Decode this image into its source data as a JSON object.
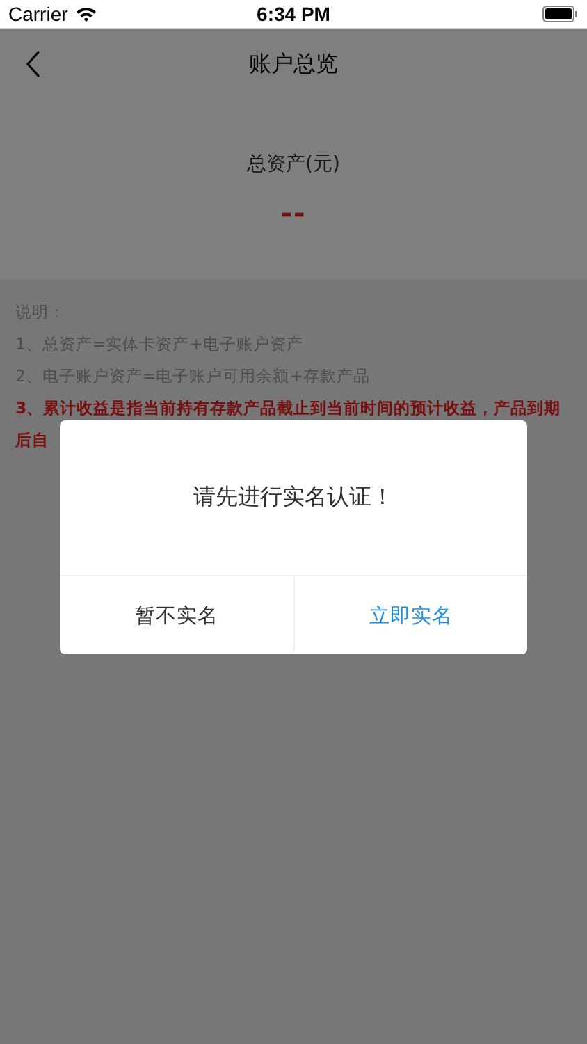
{
  "status_bar": {
    "carrier": "Carrier",
    "time": "6:34 PM"
  },
  "nav": {
    "title": "账户总览"
  },
  "summary": {
    "label": "总资产(元)",
    "value": "--"
  },
  "notes": {
    "heading": "说明：",
    "items": [
      {
        "text": "1、总资产=实体卡资产+电子账户资产",
        "kind": "normal"
      },
      {
        "text": "2、电子账户资产=电子账户可用余额+存款产品",
        "kind": "normal"
      },
      {
        "text": "3、累计收益是指当前持有存款产品截止到当前时间的预计收益，产品到期后自",
        "kind": "highlight"
      }
    ]
  },
  "dialog": {
    "message": "请先进行实名认证！",
    "buttons": [
      {
        "label": "暂不实名",
        "kind": "secondary"
      },
      {
        "label": "立即实名",
        "kind": "primary"
      }
    ]
  }
}
